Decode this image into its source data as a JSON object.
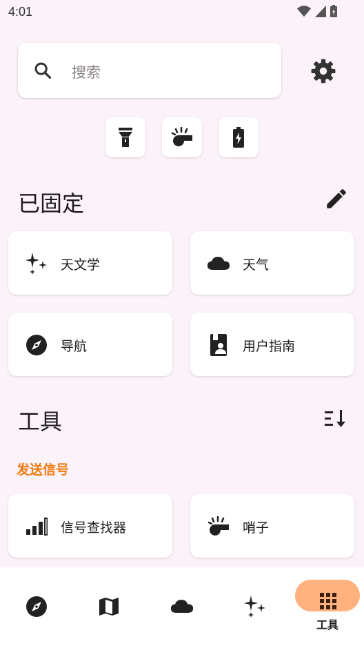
{
  "status_bar": {
    "time": "4:01"
  },
  "search": {
    "placeholder": "搜索"
  },
  "quick_actions": [
    {
      "icon": "flashlight-icon"
    },
    {
      "icon": "whistle-icon"
    },
    {
      "icon": "battery-charging-icon"
    }
  ],
  "pinned": {
    "title": "已固定",
    "tiles": [
      {
        "label": "天文学",
        "icon": "sparkles-icon"
      },
      {
        "label": "天气",
        "icon": "cloud-icon"
      },
      {
        "label": "导航",
        "icon": "compass-icon"
      },
      {
        "label": "用户指南",
        "icon": "user-guide-icon"
      }
    ]
  },
  "tools": {
    "title": "工具",
    "category": "发送信号",
    "tiles": [
      {
        "label": "信号查找器",
        "icon": "signal-bars-icon"
      },
      {
        "label": "哨子",
        "icon": "whistle-icon"
      }
    ]
  },
  "bottom_nav": {
    "items": [
      {
        "icon": "compass-icon"
      },
      {
        "icon": "map-icon"
      },
      {
        "icon": "cloud-icon"
      },
      {
        "icon": "sparkles-icon"
      },
      {
        "icon": "grid-icon",
        "label": "工具",
        "active": true
      }
    ]
  },
  "colors": {
    "background": "#FCF3FA",
    "accent": "#F07A0C",
    "active_pill": "#FFB27E"
  }
}
